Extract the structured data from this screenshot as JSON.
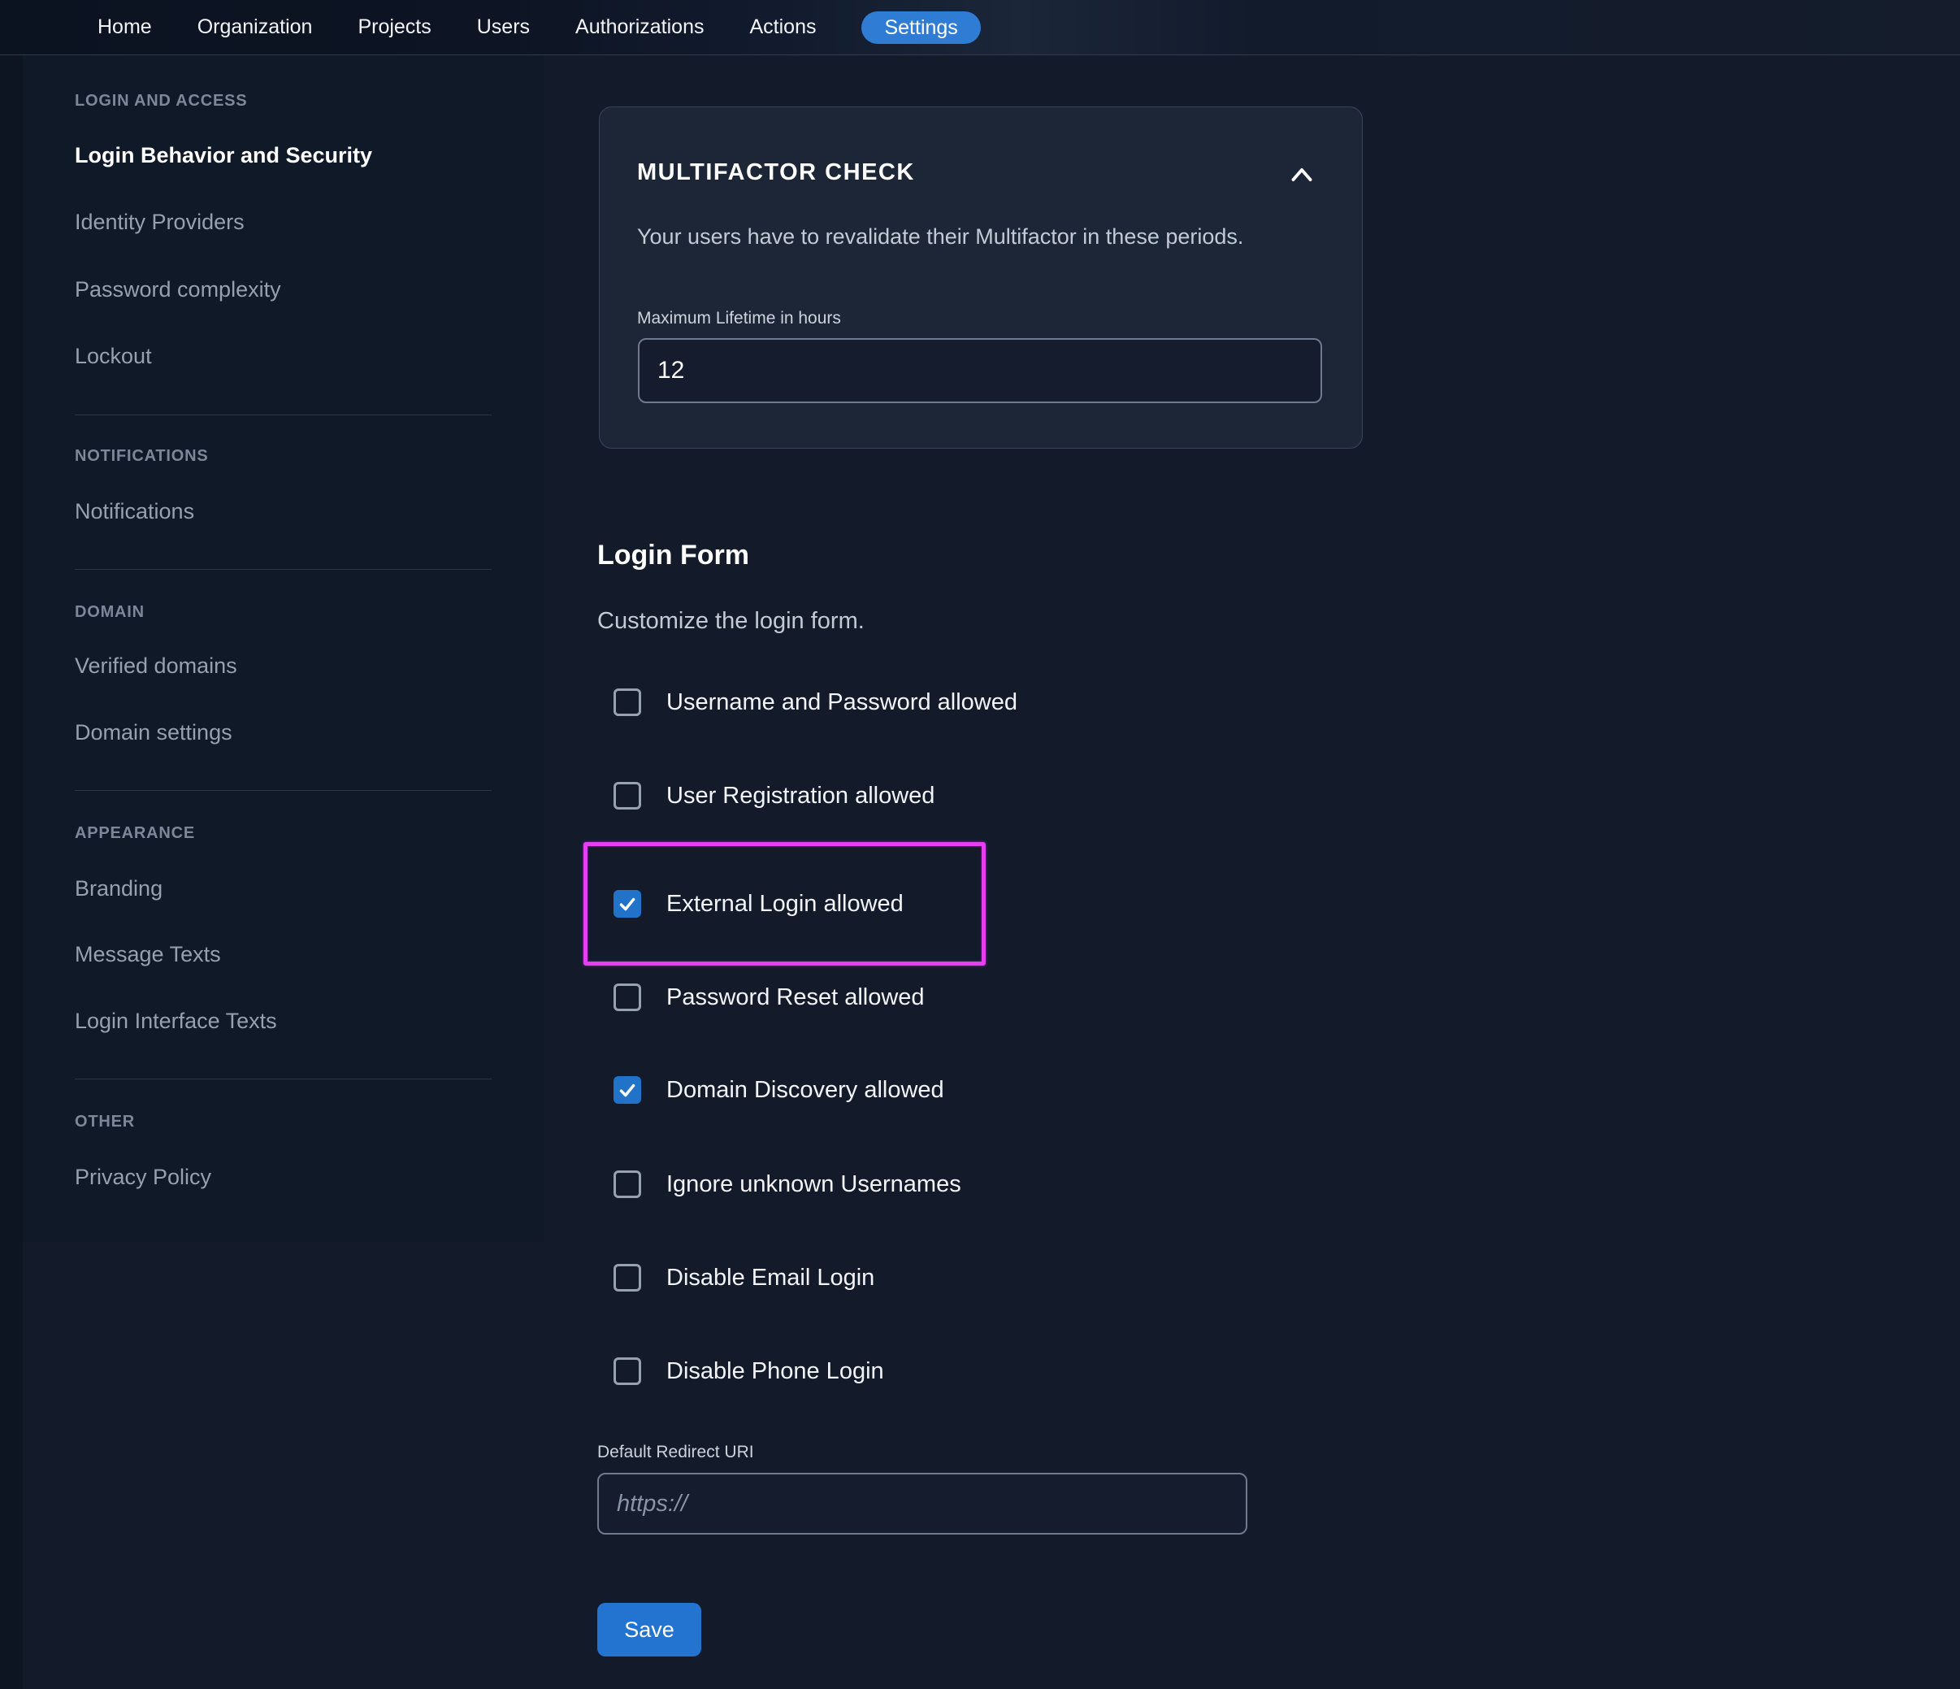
{
  "nav": {
    "items": [
      {
        "label": "Home",
        "active": false
      },
      {
        "label": "Organization",
        "active": false
      },
      {
        "label": "Projects",
        "active": false
      },
      {
        "label": "Users",
        "active": false
      },
      {
        "label": "Authorizations",
        "active": false
      },
      {
        "label": "Actions",
        "active": false
      },
      {
        "label": "Settings",
        "active": true
      }
    ]
  },
  "sidebar": {
    "groups": [
      {
        "title": "LOGIN AND ACCESS",
        "items": [
          {
            "label": "Login Behavior and Security",
            "active": true
          },
          {
            "label": "Identity Providers",
            "active": false
          },
          {
            "label": "Password complexity",
            "active": false
          },
          {
            "label": "Lockout",
            "active": false
          }
        ]
      },
      {
        "title": "NOTIFICATIONS",
        "items": [
          {
            "label": "Notifications",
            "active": false
          }
        ]
      },
      {
        "title": "DOMAIN",
        "items": [
          {
            "label": "Verified domains",
            "active": false
          },
          {
            "label": "Domain settings",
            "active": false
          }
        ]
      },
      {
        "title": "APPEARANCE",
        "items": [
          {
            "label": "Branding",
            "active": false
          },
          {
            "label": "Message Texts",
            "active": false
          },
          {
            "label": "Login Interface Texts",
            "active": false
          }
        ]
      },
      {
        "title": "OTHER",
        "items": [
          {
            "label": "Privacy Policy",
            "active": false
          }
        ]
      }
    ]
  },
  "mfa_card": {
    "title": "MULTIFACTOR CHECK",
    "collapse_icon": "chevron-up",
    "description": "Your users have to revalidate their Multifactor in these periods.",
    "lifetime_label": "Maximum Lifetime in hours",
    "lifetime_value": "12"
  },
  "login_form": {
    "title": "Login Form",
    "subtitle": "Customize the login form.",
    "checkboxes": [
      {
        "label": "Username and Password allowed",
        "checked": false,
        "highlighted": false
      },
      {
        "label": "User Registration allowed",
        "checked": false,
        "highlighted": false
      },
      {
        "label": "External Login allowed",
        "checked": true,
        "highlighted": true
      },
      {
        "label": "Password Reset allowed",
        "checked": false,
        "highlighted": false
      },
      {
        "label": "Domain Discovery allowed",
        "checked": true,
        "highlighted": false
      },
      {
        "label": "Ignore unknown Usernames",
        "checked": false,
        "highlighted": false
      },
      {
        "label": "Disable Email Login",
        "checked": false,
        "highlighted": false
      },
      {
        "label": "Disable Phone Login",
        "checked": false,
        "highlighted": false
      }
    ],
    "redirect_label": "Default Redirect URI",
    "redirect_placeholder": "https://",
    "redirect_value": "",
    "save_label": "Save"
  },
  "colors": {
    "accent_blue": "#2e7cd4",
    "checkbox_checked_blue": "#2173c9",
    "highlight_magenta": "#e73ef2",
    "card_background": "#1d2637",
    "page_background": "#131b2b",
    "sidebar_background": "#101927"
  }
}
